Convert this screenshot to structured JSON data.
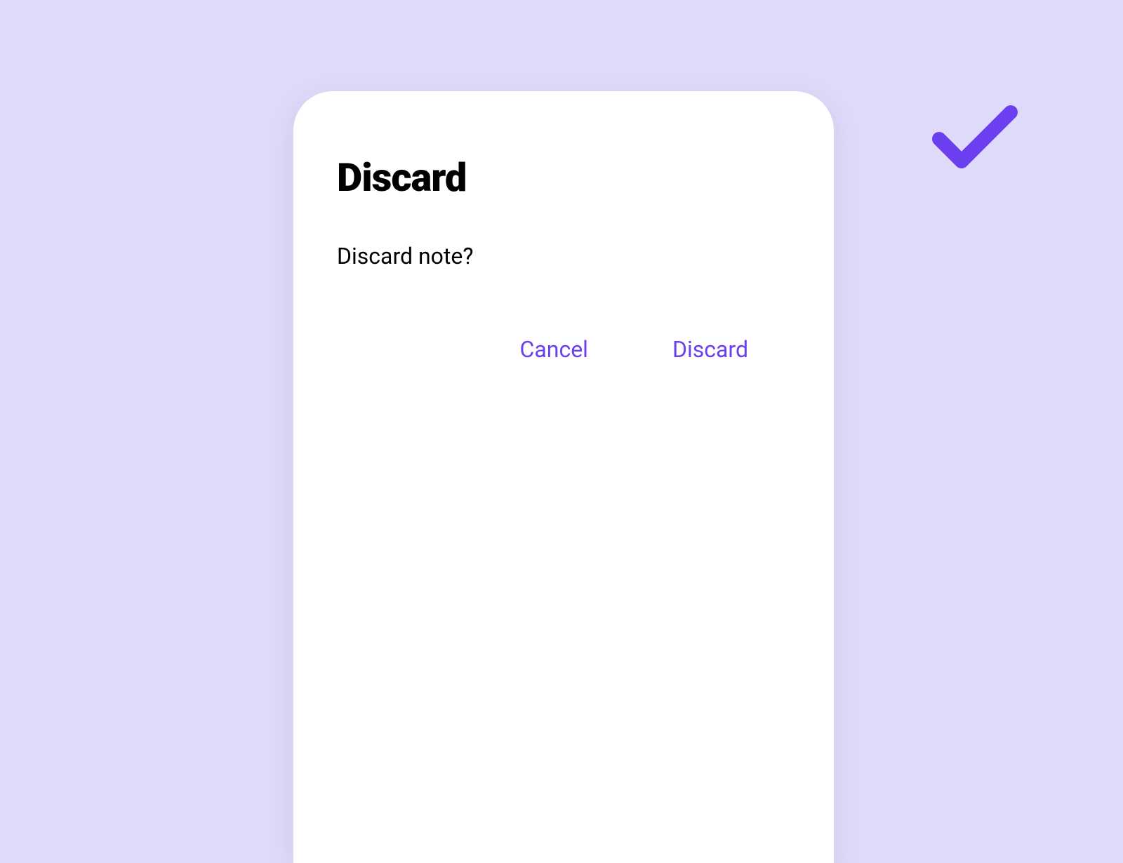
{
  "dialog": {
    "title": "Discard",
    "body": "Discard note?",
    "cancel_label": "Cancel",
    "confirm_label": "Discard"
  },
  "colors": {
    "background": "#E0DAFA",
    "card": "#FFFFFF",
    "accent": "#6B3FF0",
    "text": "#000000"
  },
  "icons": {
    "check": "check-icon"
  }
}
